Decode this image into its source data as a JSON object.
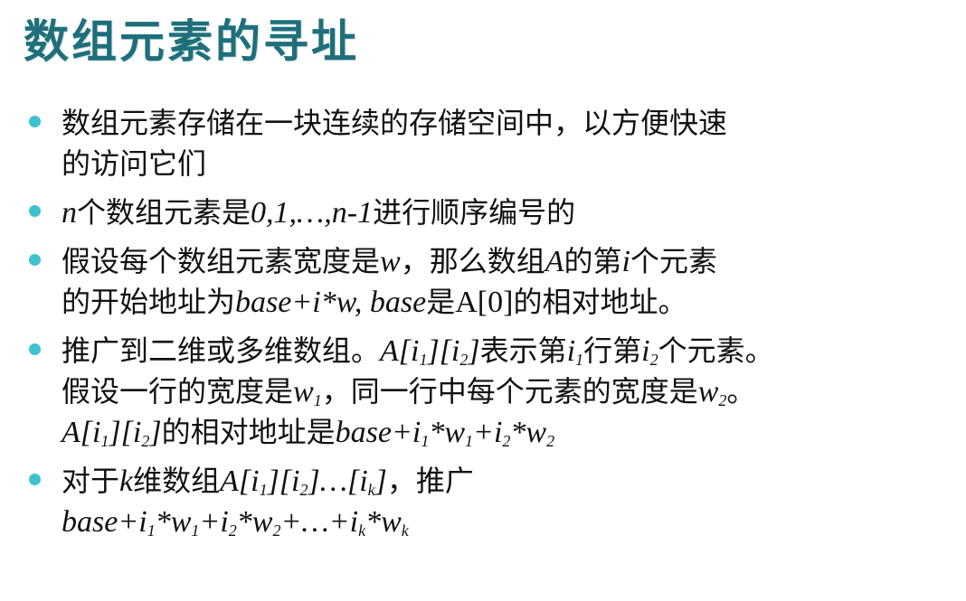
{
  "slide": {
    "title": "数组元素的寻址",
    "accent_color": "#1f6f7b",
    "bullet_color": "#3ec2cf"
  },
  "bullets": [
    {
      "b1l1": "数组元素存储在一块连续的存储空间中，以方便快速",
      "b1l2": "的访问它们"
    },
    {
      "n": "n",
      "text1": "个数组元素是",
      "seq": "0,1,…,n-1",
      "text2": "进行顺序编号的"
    },
    {
      "t1": "假设每个数组元素宽度是",
      "w": "w",
      "t2": "，那么数组",
      "A": "A",
      "t3": "的第",
      "i": "i",
      "t4": "个元素",
      "t5": "的开始地址为",
      "f1": "base+i*w, base",
      "t6": "是",
      "f2": "A[0]",
      "t7": "的相对地址。"
    },
    {
      "t1": "推广到二维或多维数组。",
      "e1a": "A[i",
      "s1": "1",
      "e1b": "][i",
      "s2": "2",
      "e1c": "]",
      "t2": "表示第",
      "i1": "i",
      "s3": "1",
      "t3": "行第",
      "i2": "i",
      "s4": "2",
      "t4": "个元素。",
      "t5": "假设一行的宽度是",
      "w1": "w",
      "s5": "1",
      "t6": "，同一行中每个元素的宽度是",
      "w2": "w",
      "s6": "2",
      "t7": "。",
      "e2a": "A[i",
      "s7": "1",
      "e2b": "][i",
      "s8": "2",
      "e2c": "]",
      "t8": "的相对地址是",
      "f1": "base+i",
      "s9": "1",
      "f2": "*w",
      "s10": "1",
      "f3": "+i",
      "s11": "2",
      "f4": "*w",
      "s12": "2"
    },
    {
      "t1": "对于",
      "k": "k",
      "t2": "维数组",
      "e1": "A[i",
      "s1": "1",
      "e2": "][i",
      "s2": "2",
      "e3": "]…[i",
      "s3": "k",
      "e4": "]",
      "t3": "，推广",
      "f1": "base+i",
      "fs1": "1",
      "f2": "*w",
      "fs2": "1",
      "f3": "+i",
      "fs3": "2",
      "f4": "*w",
      "fs4": "2",
      "f5": "+…+i",
      "fs5": "k",
      "f6": "*w",
      "fs6": "k"
    }
  ]
}
